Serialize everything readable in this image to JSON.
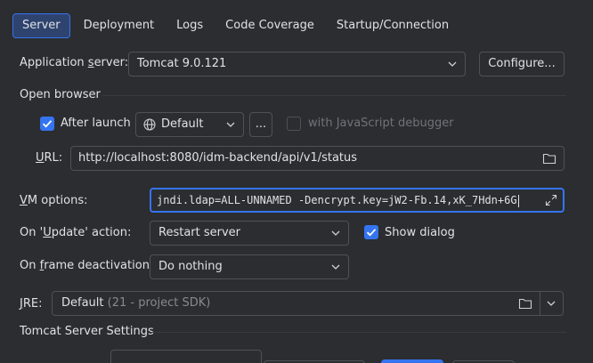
{
  "tabs": [
    "Server",
    "Deployment",
    "Logs",
    "Code Coverage",
    "Startup/Connection"
  ],
  "app_server": {
    "label_pre": "Application ",
    "label_u": "s",
    "label_post": "erver:",
    "value": "Tomcat 9.0.121",
    "configure_label": "Configure..."
  },
  "open_browser": {
    "title": "Open browser",
    "after_launch_label": "After launch",
    "after_launch_checked": true,
    "browser_value": "Default",
    "more_label": "...",
    "js_debugger_label": "with JavaScript debugger",
    "js_debugger_checked": false,
    "url_label_u": "U",
    "url_label_post": "RL:",
    "url_value": "http://localhost:8080/idm-backend/api/v1/status"
  },
  "vm_options": {
    "label_u": "V",
    "label_post": "M options:",
    "value": "jndi.ldap=ALL-UNNAMED -Dencrypt.key=jW2-Fb.14,xK_7Hdn+6G"
  },
  "on_update": {
    "label_pre": "On '",
    "label_u": "U",
    "label_post": "pdate' action:",
    "value": "Restart server",
    "show_dialog_label": "Show dialog",
    "show_dialog_checked": true
  },
  "on_frame": {
    "label_pre": "On ",
    "label_u": "f",
    "label_post": "rame deactivation:",
    "value": "Do nothing"
  },
  "jre": {
    "label_u": "J",
    "label_post": "RE:",
    "value": "Default",
    "hint": "(21 - project SDK)"
  },
  "tomcat_settings": {
    "title": "Tomcat Server Settings"
  },
  "colors": {
    "accent": "#3574f0",
    "background": "#2b2d30",
    "border": "#4e5157"
  }
}
